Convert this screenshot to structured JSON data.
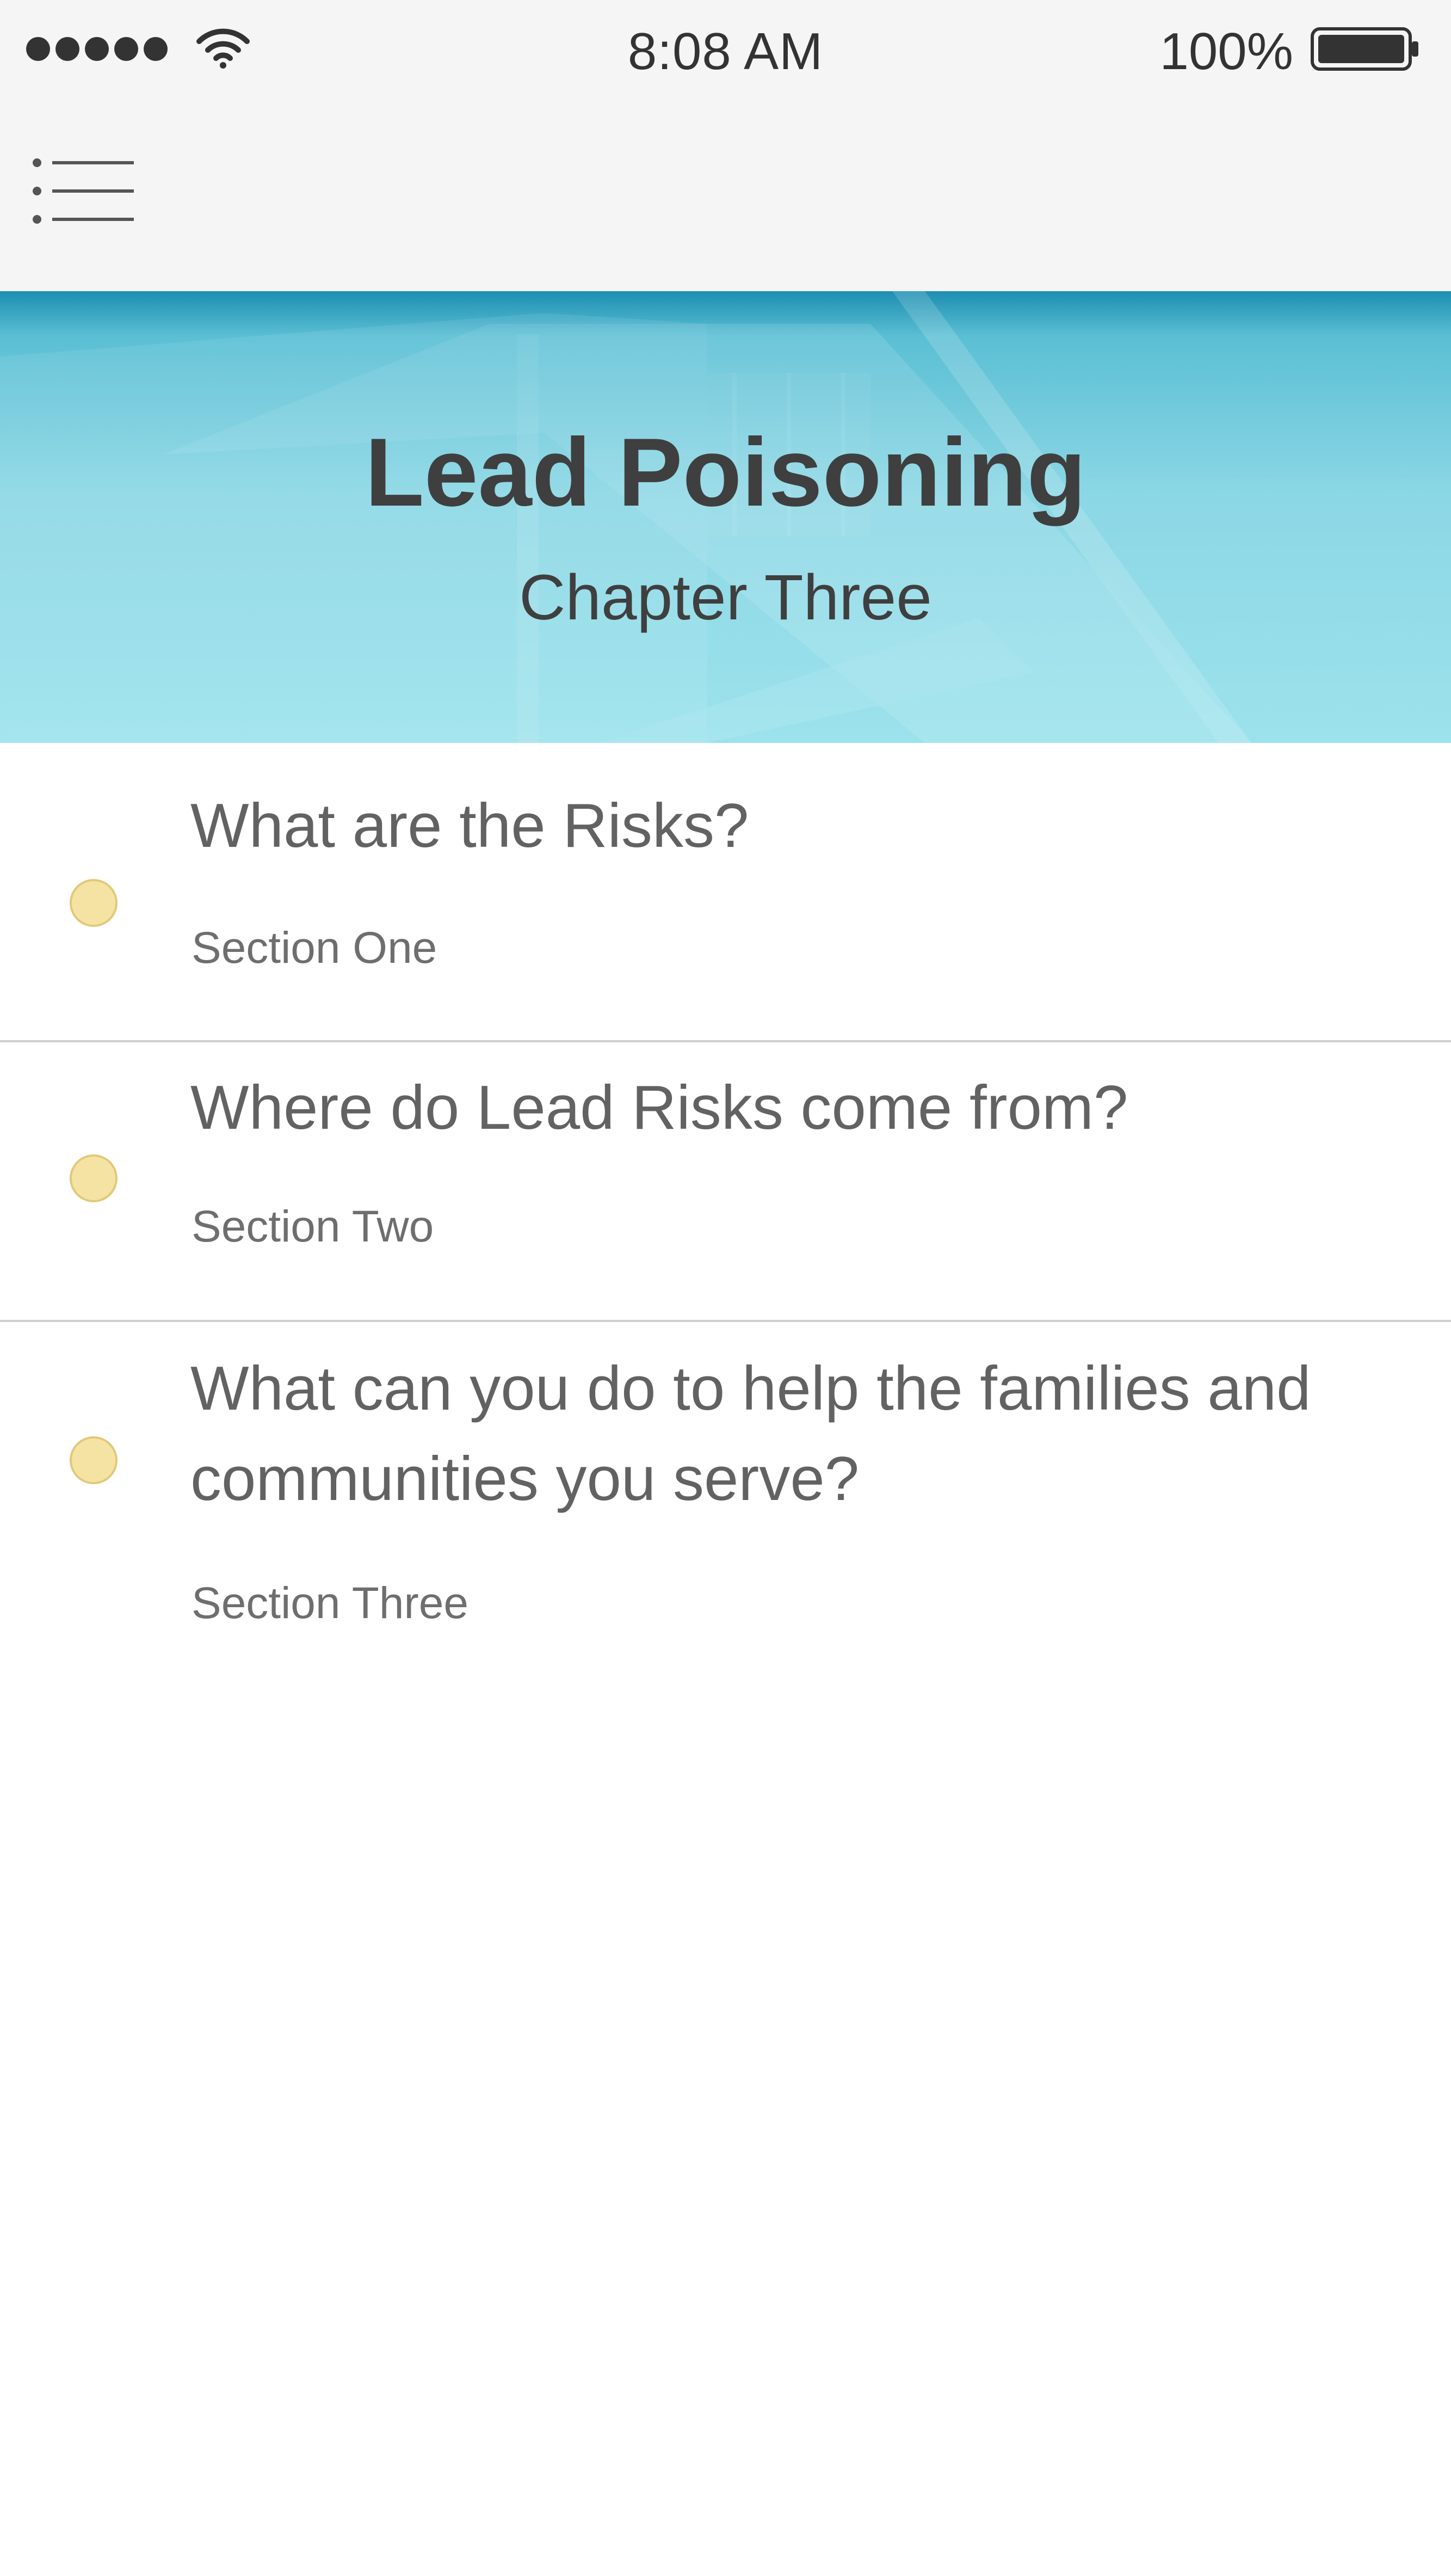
{
  "status_bar": {
    "time": "8:08 AM",
    "battery_percent": "100%",
    "signal_bars": 5,
    "icons": [
      "signal-dots-icon",
      "wifi-icon",
      "battery-icon"
    ]
  },
  "nav": {
    "menu_icon": "hamburger-menu-icon"
  },
  "hero": {
    "title": "Lead Poisoning",
    "subtitle": "Chapter Three"
  },
  "sections": [
    {
      "title": "What are the Risks?",
      "subtitle": "Section One"
    },
    {
      "title": "Where do Lead Risks come from?",
      "subtitle": "Section Two"
    },
    {
      "title": "What can you do to help the families and communities you serve?",
      "subtitle": "Section Three"
    }
  ],
  "colors": {
    "hero_top": "#1c8eb1",
    "hero_bottom": "#9ce2ec",
    "bullet_fill": "#f5e3a3",
    "bullet_stroke": "#e2c97a",
    "text_dark": "#3f3f3f",
    "text_body": "#626262",
    "nav_background": "#f5f5f5"
  }
}
